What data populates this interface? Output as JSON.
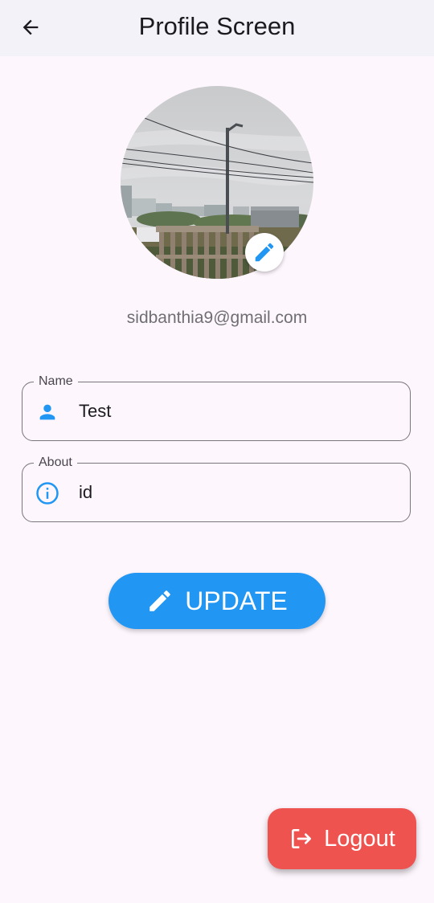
{
  "appbar": {
    "title": "Profile Screen",
    "back_icon": "arrow-back-icon"
  },
  "profile": {
    "avatar": "profile-photo",
    "edit_icon": "pencil-icon",
    "email": "sidbanthia9@gmail.com"
  },
  "form": {
    "name": {
      "label": "Name",
      "value": "Test",
      "icon": "person-icon"
    },
    "about": {
      "label": "About",
      "value": "id",
      "icon": "info-icon"
    }
  },
  "update_button": {
    "label": "UPDATE",
    "icon": "pencil-icon"
  },
  "logout_button": {
    "label": "Logout",
    "icon": "logout-icon"
  },
  "colors": {
    "primary": "#2196f3",
    "logout": "#ef5350",
    "background": "#fdf6fd",
    "appbar": "#f3f2f8"
  }
}
